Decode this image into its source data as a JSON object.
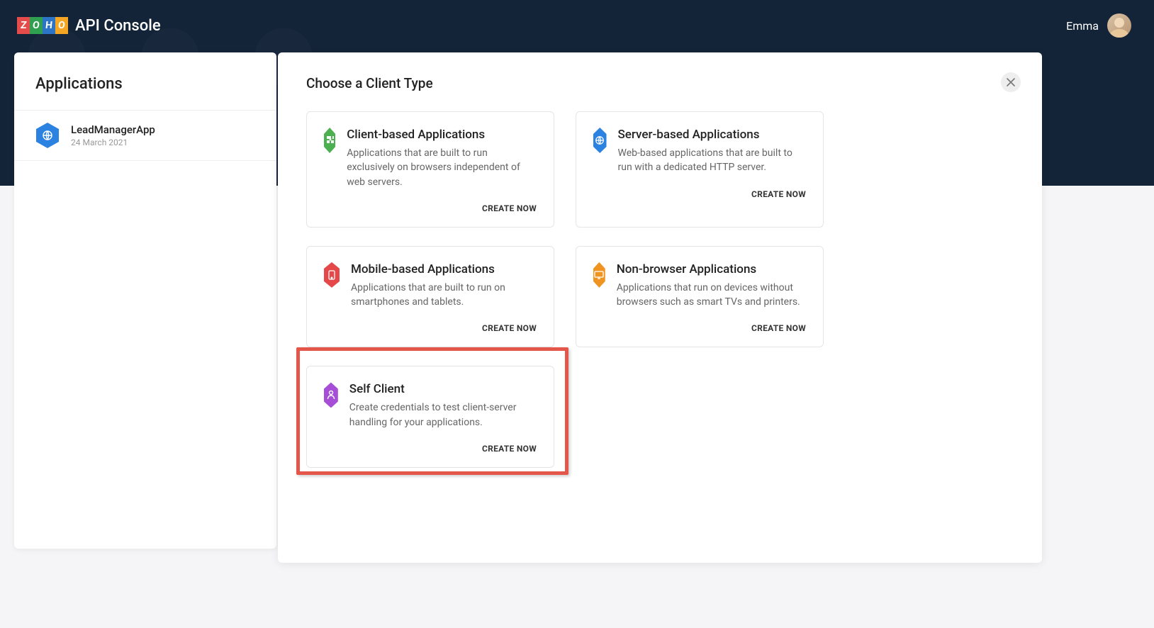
{
  "header": {
    "logoLetters": [
      "Z",
      "O",
      "H",
      "O"
    ],
    "consoleTitle": "API Console",
    "userName": "Emma"
  },
  "sidebar": {
    "title": "Applications",
    "apps": [
      {
        "name": "LeadManagerApp",
        "date": "24 March 2021"
      }
    ]
  },
  "modal": {
    "title": "Choose a Client Type",
    "createLabel": "CREATE NOW",
    "clientTypes": [
      {
        "title": "Client-based Applications",
        "desc": "Applications that are built to run exclusively on browsers independent of web servers.",
        "iconColor": "green",
        "icon": "puzzle"
      },
      {
        "title": "Server-based Applications",
        "desc": "Web-based applications that are built to run with a dedicated HTTP server.",
        "iconColor": "blue",
        "icon": "globe"
      },
      {
        "title": "Mobile-based Applications",
        "desc": "Applications that are built to run on smartphones and tablets.",
        "iconColor": "red",
        "icon": "mobile"
      },
      {
        "title": "Non-browser Applications",
        "desc": "Applications that run on devices without browsers such as smart TVs and printers.",
        "iconColor": "orange",
        "icon": "monitor"
      },
      {
        "title": "Self Client",
        "desc": "Create credentials to test client-server handling for your applications.",
        "iconColor": "purple",
        "icon": "person"
      }
    ]
  }
}
